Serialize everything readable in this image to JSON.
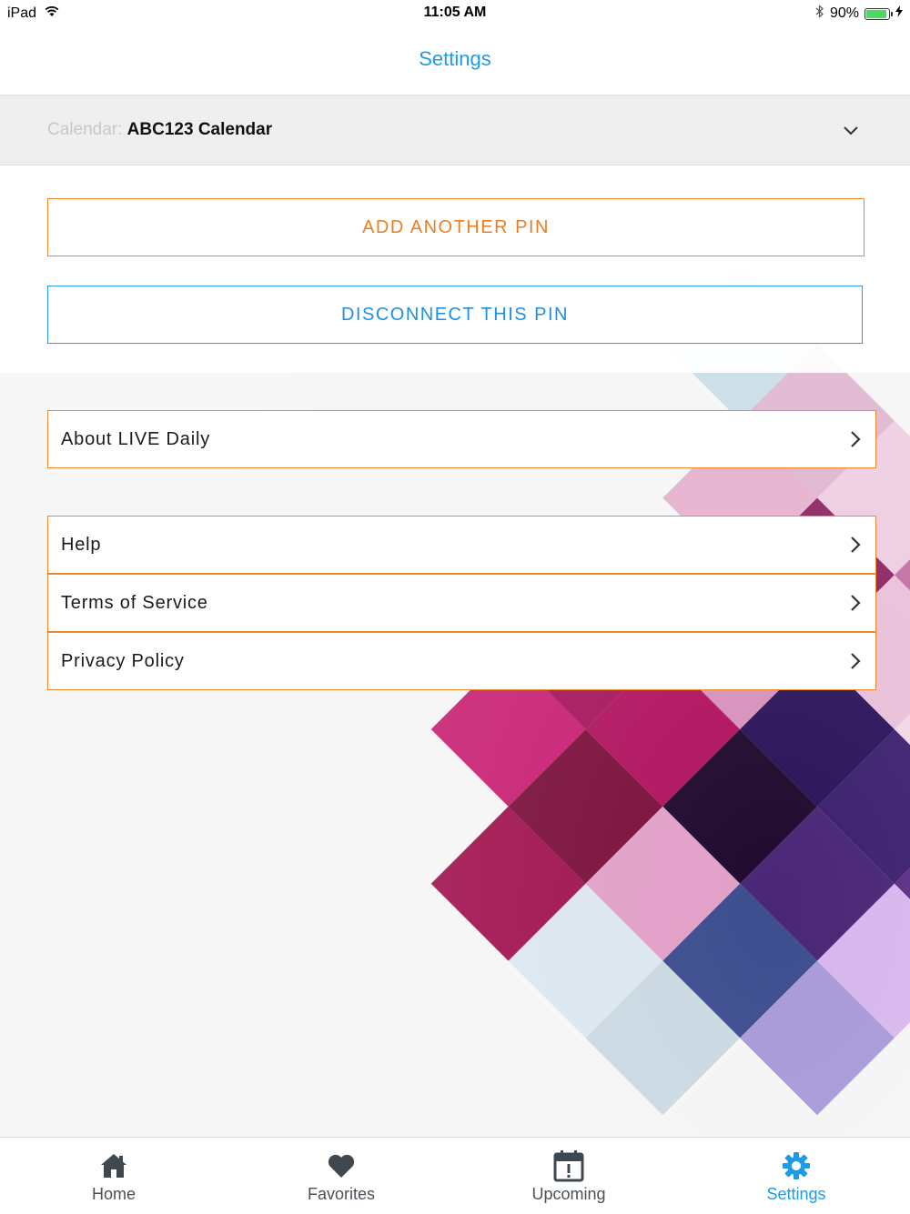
{
  "status_bar": {
    "device": "iPad",
    "time": "11:05 AM",
    "battery": "90%",
    "battery_level": 0.9
  },
  "header": {
    "title": "Settings"
  },
  "calendar": {
    "label": "Calendar: ",
    "value": "ABC123 Calendar"
  },
  "actions": {
    "add_pin": "ADD ANOTHER PIN",
    "disconnect_pin": "DISCONNECT THIS PIN"
  },
  "menu": {
    "about": "About LIVE Daily",
    "help": "Help",
    "terms": "Terms of Service",
    "privacy": "Privacy Policy"
  },
  "tabs": [
    {
      "label": "Home",
      "icon": "home-icon"
    },
    {
      "label": "Favorites",
      "icon": "heart-icon"
    },
    {
      "label": "Upcoming",
      "icon": "calendar-alert-icon"
    },
    {
      "label": "Settings",
      "icon": "gear-icon"
    }
  ],
  "colors": {
    "accent_blue": "#1e9be6",
    "accent_orange": "#ee7d22",
    "tab_inactive": "#4a5058"
  }
}
